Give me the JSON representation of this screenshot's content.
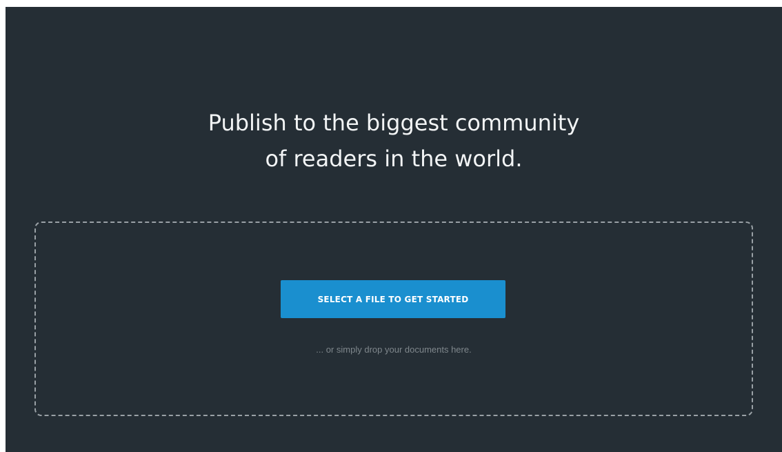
{
  "headline": {
    "line1": "Publish to the biggest community",
    "line2": "of readers in the world."
  },
  "upload": {
    "button_label": "SELECT A FILE TO GET STARTED",
    "drop_hint": "... or simply drop your documents here."
  },
  "colors": {
    "background": "#252e35",
    "accent": "#1a8fcf",
    "dashed_border": "#9aa1a6"
  }
}
